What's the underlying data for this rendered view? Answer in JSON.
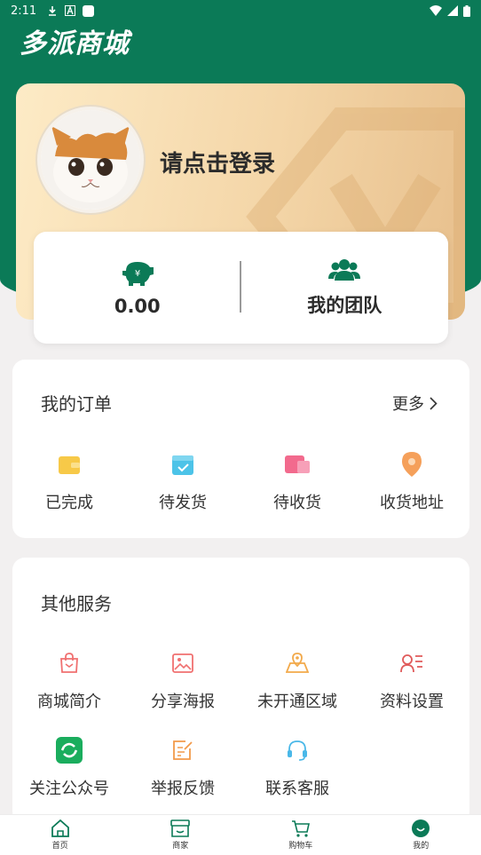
{
  "status_bar": {
    "time": "2:11"
  },
  "header": {
    "title": "多派商城"
  },
  "profile": {
    "login_prompt": "请点击登录"
  },
  "stats": {
    "balance": "0.00",
    "team_label": "我的团队"
  },
  "orders": {
    "title": "我的订单",
    "more_label": "更多",
    "items": [
      {
        "label": "已完成",
        "icon": "wallet-icon",
        "color": "#f7c948"
      },
      {
        "label": "待发货",
        "icon": "calendar-check-icon",
        "color": "#4cc3e8"
      },
      {
        "label": "待收货",
        "icon": "package-icon",
        "color": "#f26a8d"
      },
      {
        "label": "收货地址",
        "icon": "location-pin-icon",
        "color": "#f5a05a"
      }
    ]
  },
  "services": {
    "title": "其他服务",
    "items": [
      {
        "label": "商城简介",
        "icon": "shopping-bag-icon",
        "color": "#f07070"
      },
      {
        "label": "分享海报",
        "icon": "image-icon",
        "color": "#f07070"
      },
      {
        "label": "未开通区域",
        "icon": "map-icon",
        "color": "#f2a94a"
      },
      {
        "label": "资料设置",
        "icon": "user-card-icon",
        "color": "#e05a5a"
      },
      {
        "label": "关注公众号",
        "icon": "wechat-icon",
        "color": "#1aad5d"
      },
      {
        "label": "举报反馈",
        "icon": "edit-note-icon",
        "color": "#f29a4a"
      },
      {
        "label": "联系客服",
        "icon": "headset-icon",
        "color": "#4ab8e8"
      }
    ]
  },
  "tabbar": {
    "items": [
      {
        "label": "首页",
        "icon": "home-icon"
      },
      {
        "label": "商家",
        "icon": "store-icon"
      },
      {
        "label": "购物车",
        "icon": "cart-icon"
      },
      {
        "label": "我的",
        "icon": "profile-icon"
      }
    ]
  },
  "colors": {
    "brand": "#0b7a57",
    "card_gold": "#f4d6a8"
  }
}
